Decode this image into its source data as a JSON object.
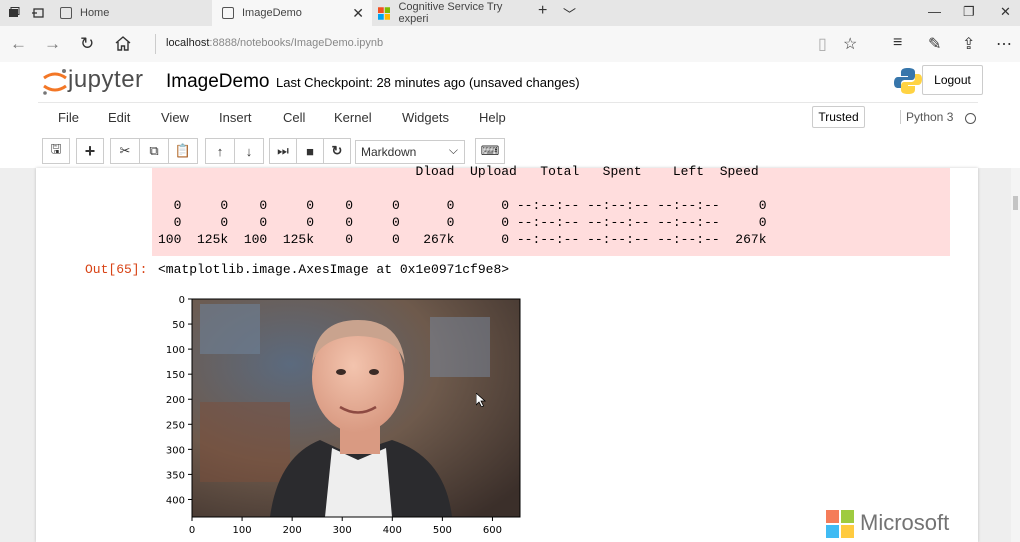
{
  "browser": {
    "tabs": [
      {
        "label": "Home"
      },
      {
        "label": "ImageDemo"
      },
      {
        "label": "Cognitive Service Try experi"
      }
    ],
    "url_host": "localhost",
    "url_rest": ":8888/notebooks/ImageDemo.ipynb"
  },
  "jupyter": {
    "logo_text": "jupyter",
    "notebook_name": "ImageDemo",
    "checkpoint": "Last Checkpoint: 28 minutes ago (unsaved changes)",
    "logout": "Logout",
    "menu": [
      "File",
      "Edit",
      "View",
      "Insert",
      "Cell",
      "Kernel",
      "Widgets",
      "Help"
    ],
    "trusted": "Trusted",
    "kernel": "Python 3",
    "cell_type": "Markdown"
  },
  "output": {
    "stderr_lines": [
      "                                 Dload  Upload   Total   Spent    Left  Speed",
      "",
      "  0     0    0     0    0     0      0      0 --:--:-- --:--:-- --:--:--     0",
      "  0     0    0     0    0     0      0      0 --:--:-- --:--:-- --:--:--     0",
      "100  125k  100  125k    0     0   267k      0 --:--:-- --:--:-- --:--:--  267k"
    ],
    "out_prompt": "Out[65]:",
    "out_text": "<matplotlib.image.AxesImage at 0x1e0971cf9e8>"
  },
  "plot": {
    "y_ticks": [
      "0",
      "50",
      "100",
      "150",
      "200",
      "250",
      "300",
      "350",
      "400"
    ],
    "x_ticks": [
      "0",
      "100",
      "200",
      "300",
      "400",
      "500",
      "600"
    ]
  },
  "watermark": "Microsoft"
}
